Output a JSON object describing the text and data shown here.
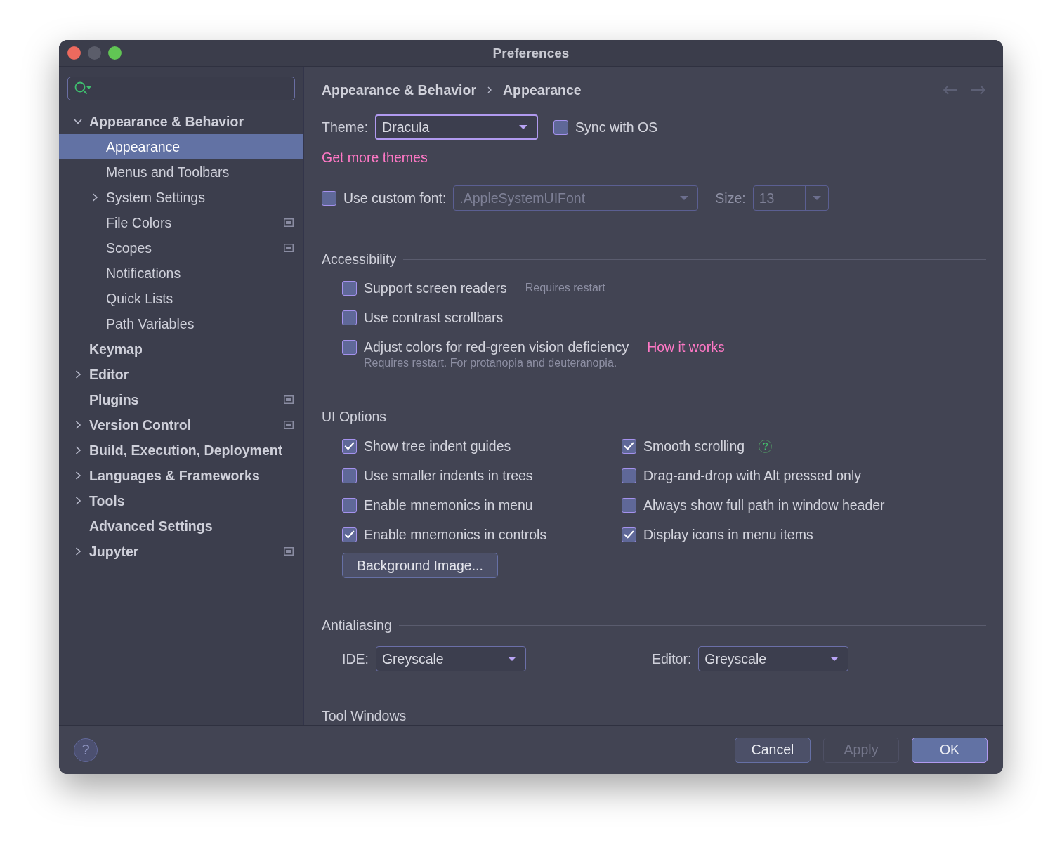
{
  "window": {
    "title": "Preferences"
  },
  "sidebar": {
    "items": [
      {
        "label": "Appearance & Behavior",
        "expandable": true,
        "expanded": true,
        "selected": false,
        "project_icon": false,
        "children": [
          {
            "label": "Appearance",
            "expandable": false,
            "selected": true,
            "project_icon": false
          },
          {
            "label": "Menus and Toolbars",
            "expandable": false,
            "selected": false,
            "project_icon": false
          },
          {
            "label": "System Settings",
            "expandable": true,
            "expanded": false,
            "selected": false,
            "project_icon": false
          },
          {
            "label": "File Colors",
            "expandable": false,
            "selected": false,
            "project_icon": true
          },
          {
            "label": "Scopes",
            "expandable": false,
            "selected": false,
            "project_icon": true
          },
          {
            "label": "Notifications",
            "expandable": false,
            "selected": false,
            "project_icon": false
          },
          {
            "label": "Quick Lists",
            "expandable": false,
            "selected": false,
            "project_icon": false
          },
          {
            "label": "Path Variables",
            "expandable": false,
            "selected": false,
            "project_icon": false
          }
        ]
      },
      {
        "label": "Keymap",
        "expandable": false,
        "selected": false,
        "project_icon": false
      },
      {
        "label": "Editor",
        "expandable": true,
        "expanded": false,
        "selected": false,
        "project_icon": false
      },
      {
        "label": "Plugins",
        "expandable": false,
        "selected": false,
        "project_icon": true
      },
      {
        "label": "Version Control",
        "expandable": true,
        "expanded": false,
        "selected": false,
        "project_icon": true
      },
      {
        "label": "Build, Execution, Deployment",
        "expandable": true,
        "expanded": false,
        "selected": false,
        "project_icon": false
      },
      {
        "label": "Languages & Frameworks",
        "expandable": true,
        "expanded": false,
        "selected": false,
        "project_icon": false
      },
      {
        "label": "Tools",
        "expandable": true,
        "expanded": false,
        "selected": false,
        "project_icon": false
      },
      {
        "label": "Advanced Settings",
        "expandable": false,
        "selected": false,
        "project_icon": false
      },
      {
        "label": "Jupyter",
        "expandable": true,
        "expanded": false,
        "selected": false,
        "project_icon": true
      }
    ]
  },
  "breadcrumb": [
    "Appearance & Behavior",
    "Appearance"
  ],
  "theme": {
    "label": "Theme:",
    "value": "Dracula",
    "focused": true,
    "sync": {
      "label": "Sync with OS",
      "checked": false
    },
    "link": "Get more themes"
  },
  "custom_font": {
    "label": "Use custom font:",
    "checked": false,
    "value": ".AppleSystemUIFont",
    "disabled": true,
    "size_label": "Size:",
    "size_value": "13"
  },
  "accessibility": {
    "title": "Accessibility",
    "options": [
      {
        "label": "Support screen readers",
        "checked": false,
        "note": "Requires restart"
      },
      {
        "label": "Use contrast scrollbars",
        "checked": false
      },
      {
        "label": "Adjust colors for red-green vision deficiency",
        "checked": false,
        "link": "How it works",
        "comment": "Requires restart. For protanopia and deuteranopia."
      }
    ]
  },
  "ui_options": {
    "title": "UI Options",
    "columns": [
      [
        {
          "label": "Show tree indent guides",
          "checked": true
        },
        {
          "label": "Use smaller indents in trees",
          "checked": false
        },
        {
          "label": "Enable mnemonics in menu",
          "checked": false
        },
        {
          "label": "Enable mnemonics in controls",
          "checked": true
        }
      ],
      [
        {
          "label": "Smooth scrolling",
          "checked": true,
          "help": "?"
        },
        {
          "label": "Drag-and-drop with Alt pressed only",
          "checked": false
        },
        {
          "label": "Always show full path in window header",
          "checked": false
        },
        {
          "label": "Display icons in menu items",
          "checked": true
        }
      ]
    ],
    "button": "Background Image..."
  },
  "antialiasing": {
    "title": "Antialiasing",
    "fields": [
      {
        "label": "IDE:",
        "value": "Greyscale"
      },
      {
        "label": "Editor:",
        "value": "Greyscale"
      }
    ]
  },
  "tool_windows": {
    "title": "Tool Windows"
  },
  "footer": {
    "help": "?",
    "buttons": [
      {
        "label": "Cancel",
        "kind": "normal",
        "disabled": false
      },
      {
        "label": "Apply",
        "kind": "normal",
        "disabled": true
      },
      {
        "label": "OK",
        "kind": "default",
        "disabled": false
      }
    ]
  }
}
